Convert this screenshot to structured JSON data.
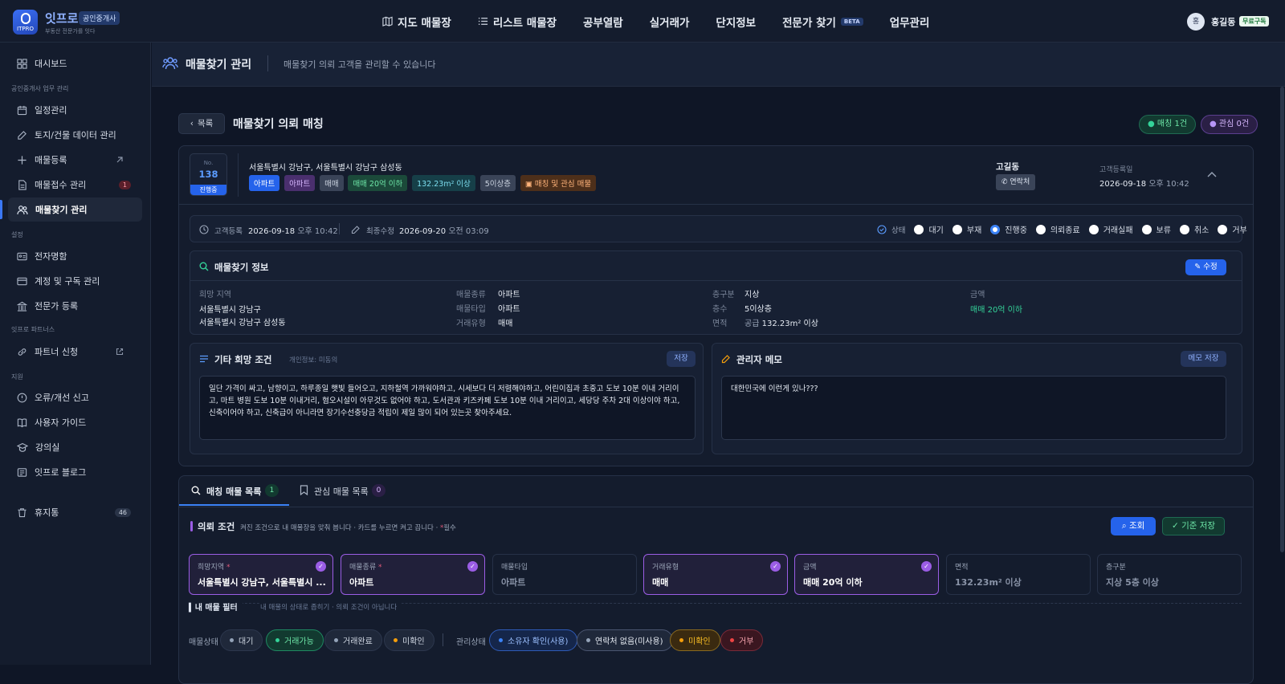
{
  "app": {
    "brand": "잇프로",
    "brand_badge": "공인중개사",
    "tagline": "부동산 전문가를 잇다",
    "logo_text": "ITPRO"
  },
  "nav": {
    "items": [
      "지도 매물장",
      "리스트 매물장",
      "공부열람",
      "실거래가",
      "단지정보",
      "전문가 찾기",
      "업무관리"
    ],
    "beta": "BETA"
  },
  "user": {
    "avatar": "홍",
    "name": "홍길동",
    "plan": "무료구독"
  },
  "sidebar": {
    "dashboard": "대시보드",
    "section1": "공인중개사 업무 관리",
    "items1": [
      "일정관리",
      "토지/건물 데이터 관리",
      "매물등록",
      "매물접수 관리",
      "매물찾기 관리"
    ],
    "intake_count": "1",
    "section2": "설정",
    "items2": [
      "전자명함",
      "계정 및 구독 관리",
      "전문가 등록"
    ],
    "section3": "잇프로 파트너스",
    "items3": [
      "파트너 신청"
    ],
    "section4": "지원",
    "items4": [
      "오류/개선 신고",
      "사용자 가이드",
      "강의실",
      "잇프로 블로그"
    ],
    "trash": "휴지통",
    "trash_count": "46"
  },
  "page": {
    "title": "매물찾기 관리",
    "subtitle": "매물찾기 의뢰 고객을 관리할 수 있습니다"
  },
  "detail": {
    "back": "목록",
    "title": "매물찾기 의뢰 매칭",
    "match_badge": "매칭 1건",
    "interest_badge": "관심 0건"
  },
  "request": {
    "no_label": "No.",
    "no": "138",
    "status": "진행중",
    "address": "서울특별시 강남구, 서울특별시 강남구 삼성동",
    "tags": [
      "아파트",
      "아파트",
      "매매",
      "매매 20억 이하",
      "132.23m² 이상",
      "5이상층",
      "매칭 및 관심 매물"
    ],
    "customer": "고길동",
    "contact": "연락처",
    "reg_label": "고객등록일",
    "reg_date": "2026-09-18",
    "reg_time": "오후 10:42"
  },
  "meta": {
    "reg_label": "고객등록",
    "reg_date": "2026-09-18",
    "reg_time": "오후 10:42",
    "mod_label": "최종수정",
    "mod_date": "2026-09-20",
    "mod_time": "오전 03:09",
    "state_label": "상태",
    "states": [
      "대기",
      "부재",
      "진행중",
      "의뢰종료",
      "거래실패",
      "보류",
      "취소",
      "거부"
    ],
    "selected_state": "진행중"
  },
  "info": {
    "title": "매물찾기 정보",
    "edit": "수정",
    "region_label": "희망 지역",
    "regions": [
      "서울특별시 강남구",
      "서울특별시 강남구 삼성동"
    ],
    "type_label": "매물종류",
    "type_value": "아파트",
    "subtype_label": "매물타입",
    "subtype_value": "아파트",
    "deal_label": "거래유형",
    "deal_value": "매매",
    "floor_kind_label": "층구분",
    "floor_kind_value": "지상",
    "floors_label": "층수",
    "floors_value": "5이상층",
    "area_label": "면적",
    "area_prefix": "공급",
    "area_value": "132.23m² 이상",
    "price_label": "금액",
    "price_value": "매매 20억 이하"
  },
  "conditions": {
    "title": "기타 희망 조건",
    "note": "개인정보: 미동의",
    "save": "저장",
    "text": "일단 가격이 싸고, 남향이고, 하루종일 햇빛 들어오고, 지하철역 가까워야하고, 시세보다 더 저렴해야하고, 어린이집과 초중고 도보 10분 이내 거리이고, 마트 병원 도보 10분 이내거리, 혐오시설이 아무것도 없어야 하고, 도서관과 키즈카페 도보 10분 이내 거리이고, 세당당 주차 2대 이상이야 하고, 신축이어야 하고, 신축급이 아니라면 장기수선충당금 적립이 제일 많이 되어 있는곳 찾아주세요."
  },
  "memo": {
    "title": "관리자 메모",
    "save": "메모 저장",
    "text": "대한민국에 이런게 있나???"
  },
  "tabs": {
    "matching": "매칭 매물 목록",
    "matching_count": "1",
    "interest": "관심 매물 목록",
    "interest_count": "0"
  },
  "criteria": {
    "title": "의뢰 조건",
    "desc": "켜진 조건으로 내 매물장을 맞춰 봅니다 · 카드를 누르면 켜고 끕니다 ·",
    "required_mark": "*",
    "required_text": "필수",
    "search": "조회",
    "save": "기준 저장",
    "cards": [
      {
        "label": "희망지역",
        "value": "서울특별시 강남구, 서울특별시 ...",
        "on": true,
        "required": true
      },
      {
        "label": "매물종류",
        "value": "아파트",
        "on": true,
        "required": true
      },
      {
        "label": "매물타입",
        "value": "아파트",
        "on": false,
        "required": false
      },
      {
        "label": "거래유형",
        "value": "매매",
        "on": true,
        "required": false
      },
      {
        "label": "금액",
        "value": "매매 20억 이하",
        "on": true,
        "required": false
      },
      {
        "label": "면적",
        "value": "132.23m² 이상",
        "on": false,
        "required": false
      },
      {
        "label": "층구분",
        "value": "지상 5층 이상",
        "on": false,
        "required": false
      }
    ]
  },
  "filter": {
    "title": "내 매물 필터",
    "note": "내 매물의 상태로 좁히기 · 의뢰 조건이 아닙니다",
    "status_label": "매물상태",
    "statuses": [
      "대기",
      "거래가능",
      "거래완료",
      "미확인"
    ],
    "manage_label": "관리상태",
    "manages": [
      "소유자 확인(사용)",
      "연락처 없음(미사용)",
      "미확인",
      "거부"
    ],
    "colors": {
      "green": "#34d399",
      "orange": "#f59e0b",
      "blue": "#3b82f6",
      "red": "#ef4444",
      "gray": "#94a3b8"
    }
  }
}
